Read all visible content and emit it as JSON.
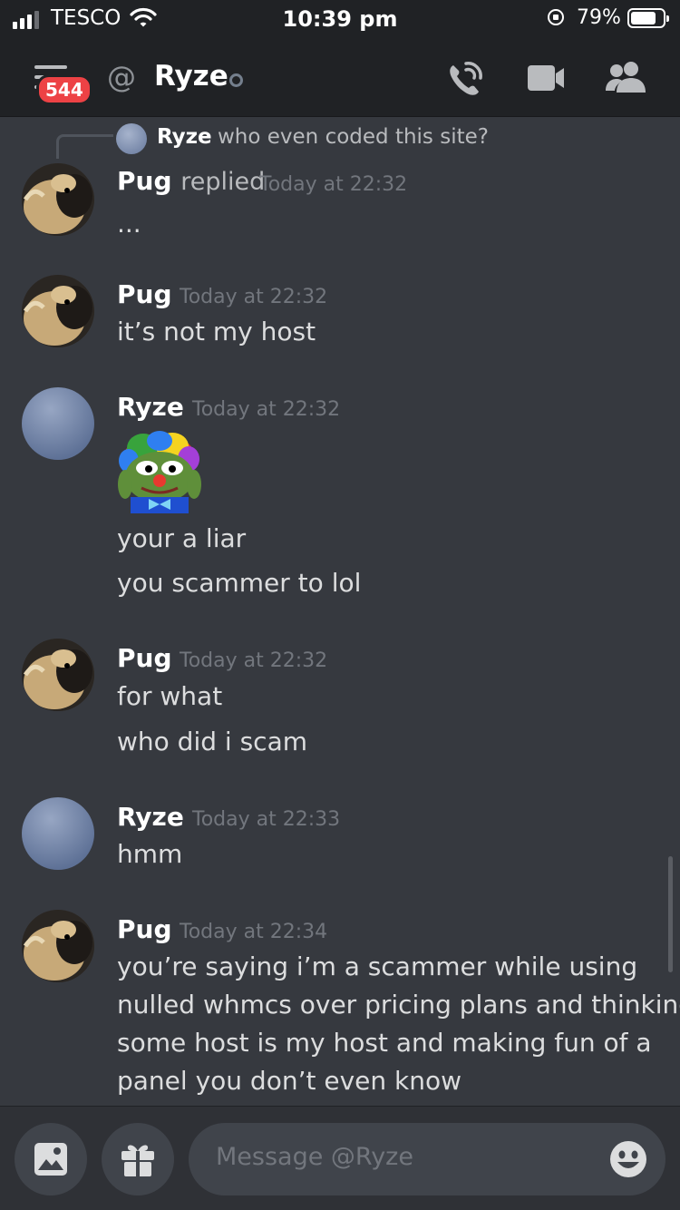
{
  "status_bar": {
    "carrier": "TESCO",
    "time": "10:39 pm",
    "battery_pct": "79%",
    "battery_level": 0.79,
    "signal_bars": 3
  },
  "header": {
    "mention_count": "544",
    "at_symbol": "@",
    "title": "Ryze"
  },
  "reply_preview": {
    "name": "Ryze",
    "text": "who even coded this site?"
  },
  "messages": [
    {
      "author": "Pug",
      "replied": "replied",
      "timestamp": "Today at 22:32",
      "lines": [
        "..."
      ]
    },
    {
      "author": "Pug",
      "timestamp": "Today at 22:32",
      "lines": [
        "it’s not my host"
      ]
    },
    {
      "author": "Ryze",
      "timestamp": "Today at 22:32",
      "has_emote": true,
      "lines": [
        "your a liar",
        "you scammer to lol"
      ]
    },
    {
      "author": "Pug",
      "timestamp": "Today at 22:32",
      "lines": [
        "for what",
        "who did i scam"
      ]
    },
    {
      "author": "Ryze",
      "timestamp": "Today at 22:33",
      "lines": [
        "hmm"
      ]
    },
    {
      "author": "Pug",
      "timestamp": "Today at 22:34",
      "lines": [
        "you’re saying i’m a scammer while using",
        "nulled whmcs over pricing plans and thinking",
        "some host is my host and making fun of a",
        "panel you don’t even know"
      ]
    }
  ],
  "composer": {
    "placeholder": "Message @Ryze"
  },
  "icons": {
    "header_left": "menu-icon",
    "call": "phone-call-icon",
    "video": "video-camera-icon",
    "members": "members-icon",
    "image": "image-icon",
    "gift": "gift-icon",
    "emoji": "emoji-icon",
    "wifi": "wifi-icon",
    "orientation_lock": "orientation-lock-icon"
  },
  "colors": {
    "background": "#36393f",
    "header": "#202225",
    "badge": "#ed4245",
    "input": "#40444b"
  }
}
